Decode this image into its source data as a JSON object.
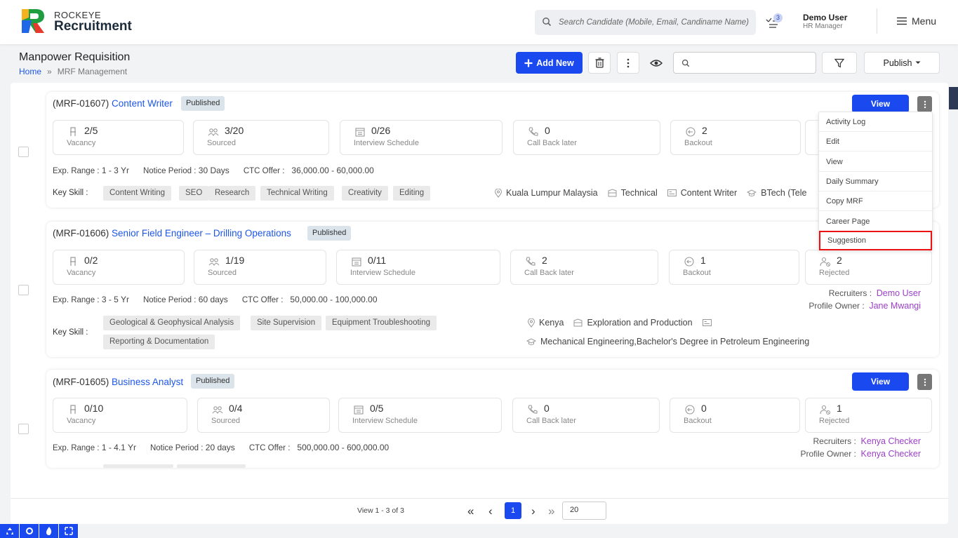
{
  "brand": {
    "top": "ROCKEYE",
    "main": "Recruitment"
  },
  "header": {
    "search_placeholder": "Search Candidate (Mobile, Email, Candiname Name)",
    "notif_count": "3",
    "user_name": "Demo User",
    "user_role": "HR Manager",
    "menu_label": "Menu"
  },
  "page": {
    "title": "Manpower Requisition",
    "breadcrumb_home": "Home",
    "breadcrumb_sep": "»",
    "breadcrumb_current": "MRF Management",
    "add_new": "Add New",
    "publish": "Publish"
  },
  "labels": {
    "vacancy": "Vacancy",
    "sourced": "Sourced",
    "interview": "Interview Schedule",
    "callback": "Call Back later",
    "backout": "Backout",
    "rejected": "Rejected",
    "exp": "Exp. Range :",
    "notice": "Notice Period :",
    "ctc": "CTC Offer :",
    "key_skill": "Key Skill :",
    "recruiters": "Recruiters :",
    "profile_owner": "Profile Owner :",
    "view": "View",
    "published": "Published"
  },
  "mrfs": [
    {
      "code": "(MRF-01607)",
      "name": "Content Writer",
      "vacancy": "2/5",
      "sourced": "3/20",
      "interview": "0/26",
      "callback": "0",
      "backout": "2",
      "exp": "1 - 3 Yr",
      "notice": "30 Days",
      "ctc": "36,000.00 - 60,000.00",
      "skills": [
        "Content Writing",
        "SEO",
        "Research",
        "Technical Writing",
        "Creativity",
        "Editing"
      ],
      "location": "Kuala Lumpur Malaysia",
      "department": "Technical",
      "designation": "Content Writer",
      "education": "BTech (Tele"
    },
    {
      "code": "(MRF-01606)",
      "name": "Senior Field Engineer – Drilling Operations",
      "vacancy": "0/2",
      "sourced": "1/19",
      "interview": "0/11",
      "callback": "2",
      "backout": "1",
      "rejected": "2",
      "exp": "3 - 5 Yr",
      "notice": "60 days",
      "ctc": "50,000.00 - 100,000.00",
      "skills": [
        "Geological & Geophysical Analysis",
        "Site Supervision",
        "Equipment Troubleshooting",
        "Reporting & Documentation"
      ],
      "location": "Kenya",
      "department": "Exploration and Production",
      "education": "Mechanical Engineering,Bachelor's Degree in Petroleum Engineering",
      "recruiters": "Demo User",
      "profile_owner": "Jane Mwangi"
    },
    {
      "code": "(MRF-01605)",
      "name": "Business Analyst",
      "vacancy": "0/10",
      "sourced": "0/4",
      "interview": "0/5",
      "callback": "0",
      "backout": "0",
      "rejected": "1",
      "exp": "1 - 4.1 Yr",
      "notice": "20 days",
      "ctc": "500,000.00 - 600,000.00",
      "recruiters": "Kenya Checker",
      "profile_owner": "Kenya Checker"
    }
  ],
  "dropdown": [
    "Activity Log",
    "Edit",
    "View",
    "Daily Summary",
    "Copy MRF",
    "Career Page",
    "Suggestion"
  ],
  "pagination": {
    "view_text": "View 1 - 3 of 3",
    "current": "1",
    "page_size": "20"
  },
  "colors": {
    "primary": "#1a49f0",
    "link": "#1d56e8",
    "recruiter": "#9b3fc8",
    "highlight": "#ee1111"
  }
}
